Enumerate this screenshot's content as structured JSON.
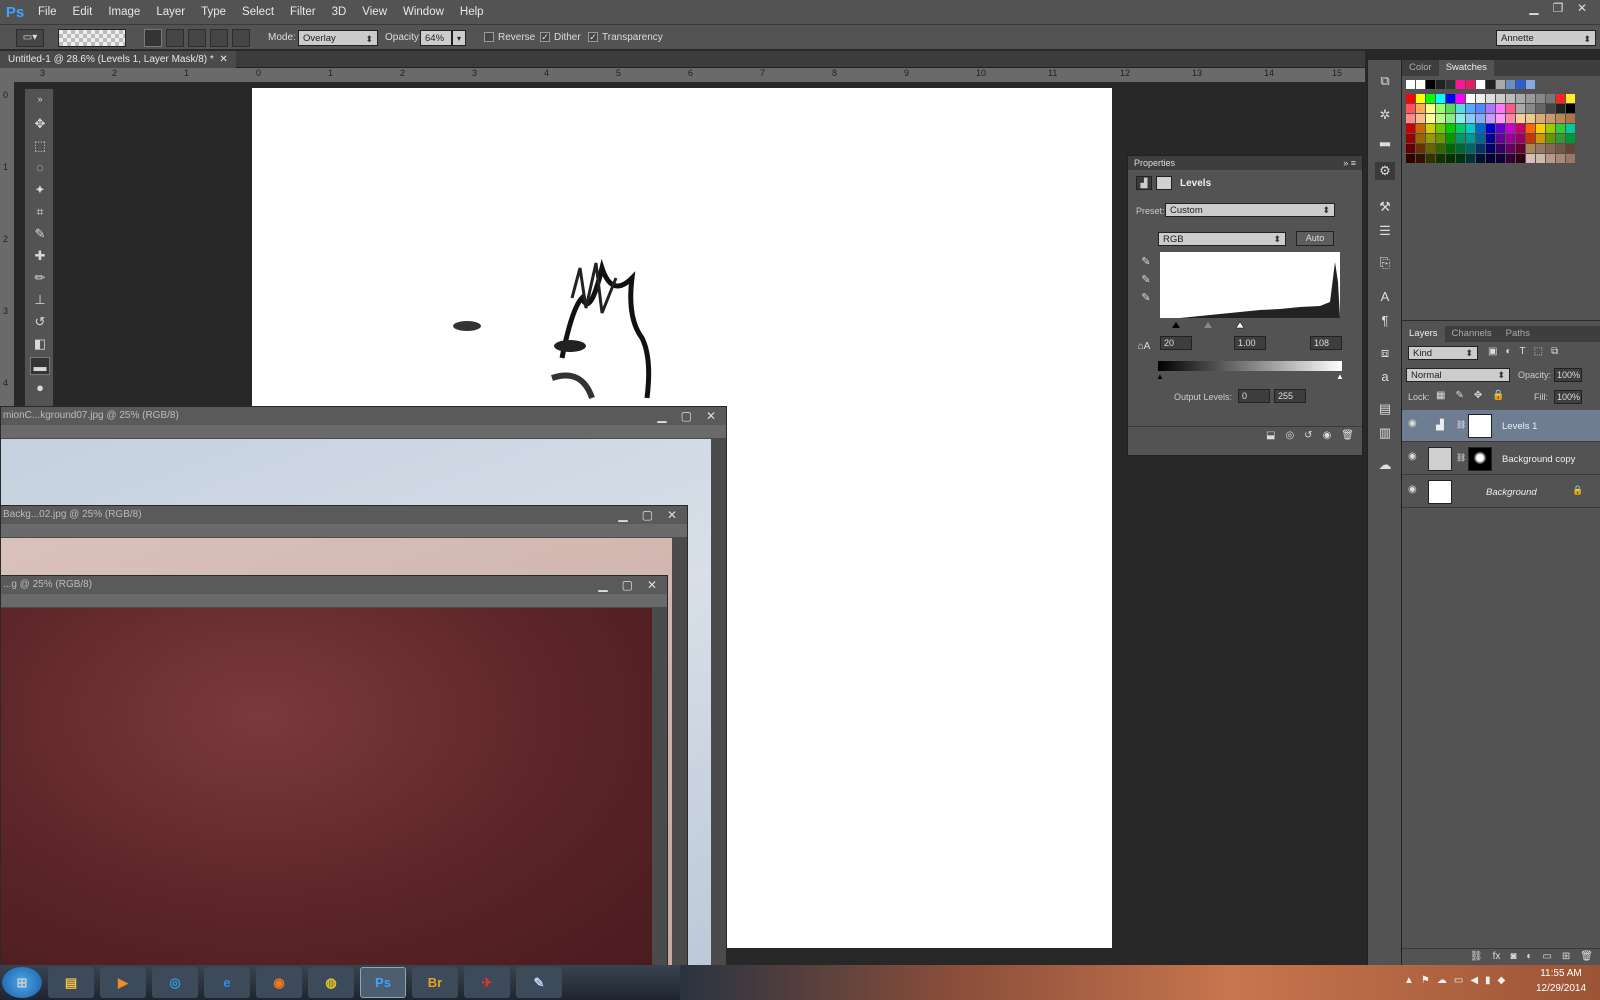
{
  "menubar": {
    "logo": "Ps",
    "items": [
      "File",
      "Edit",
      "Image",
      "Layer",
      "Type",
      "Select",
      "Filter",
      "3D",
      "View",
      "Window",
      "Help"
    ]
  },
  "options": {
    "mode_label": "Mode:",
    "mode_value": "Overlay",
    "opacity_label": "Opacity:",
    "opacity_value": "64%",
    "reverse": "Reverse",
    "dither": "Dither",
    "transparency": "Transparency",
    "workspace": "Annette"
  },
  "doc_tab": "Untitled-1 @ 28.6% (Levels 1, Layer Mask/8) *",
  "ruler_top": [
    "3",
    "2",
    "1",
    "0",
    "1",
    "2",
    "3",
    "4",
    "5",
    "6",
    "7",
    "8",
    "9",
    "10",
    "11",
    "12",
    "13",
    "14",
    "15"
  ],
  "ruler_left": [
    "0",
    "1",
    "2",
    "3",
    "4"
  ],
  "floating_windows": [
    {
      "title": "mionC...kground07.jpg @ 25% (RGB/8)"
    },
    {
      "title": "Backg...02.jpg @ 25% (RGB/8)"
    },
    {
      "title": "...g @ 25% (RGB/8)"
    }
  ],
  "properties": {
    "panel_title": "Properties",
    "adjustment": "Levels",
    "preset_label": "Preset:",
    "preset_value": "Custom",
    "channel": "RGB",
    "auto": "Auto",
    "input_black": "20",
    "input_gamma": "1.00",
    "input_white": "108",
    "output_label": "Output Levels:",
    "output_black": "0",
    "output_white": "255"
  },
  "swatch_tabs": [
    "Color",
    "Swatches"
  ],
  "layers_panel": {
    "tabs": [
      "Layers",
      "Channels",
      "Paths"
    ],
    "kind": "Kind",
    "blend": "Normal",
    "opacity_label": "Opacity:",
    "opacity": "100%",
    "lock_label": "Lock:",
    "fill_label": "Fill:",
    "fill": "100%",
    "layers": [
      {
        "name": "Levels 1"
      },
      {
        "name": "Background copy"
      },
      {
        "name": "Background"
      }
    ]
  },
  "taskbar": {
    "time": "11:55 AM",
    "date": "12/29/2014",
    "apps": [
      "start",
      "explorer",
      "media",
      "security",
      "ie",
      "firefox",
      "chrome",
      "Ps",
      "Br",
      "acrobat",
      "paint"
    ]
  },
  "colors": {
    "accent": "#3fa3ff",
    "selected_layer": "#6e7d91"
  }
}
